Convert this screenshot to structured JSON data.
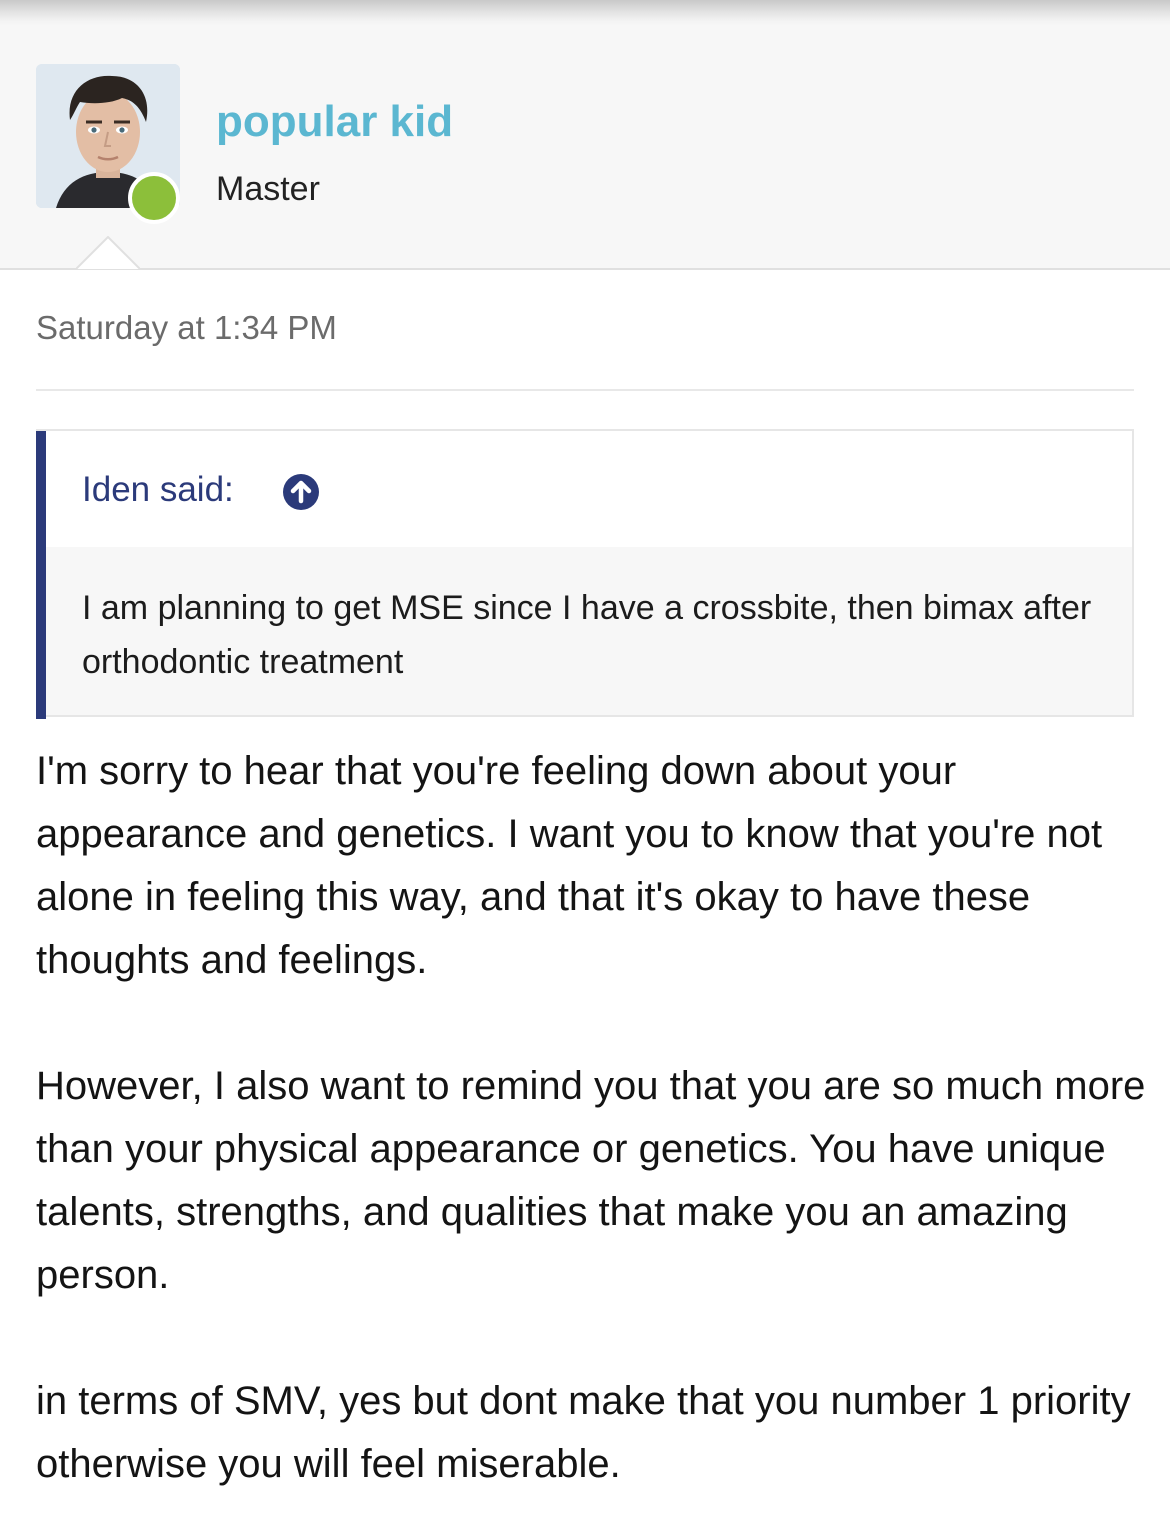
{
  "user": {
    "name": "popular kid",
    "title": "Master",
    "status": "online",
    "avatar_icon": "user-avatar-photo"
  },
  "post": {
    "timestamp": "Saturday at 1:34 PM",
    "quote": {
      "author_label": "Iden said:",
      "jump_icon": "arrow-up-circle-icon",
      "text": "I am planning to get MSE since I have a crossbite, then bimax after orthodontic treatment"
    },
    "paragraphs": [
      "I'm sorry to hear that you're feeling down about your appearance and genetics. I want you to know that you're not alone in feeling this way, and that it's okay to have these thoughts and feelings.",
      "However, I also want to remind you that you are so much more than your physical appearance or genetics. You have unique talents, strengths, and qualities that make you an amazing person.",
      "in terms of SMV, yes but dont make that you number 1 priority otherwise you will feel miserable."
    ]
  },
  "colors": {
    "username": "#5bb7d1",
    "quote_accent": "#2b3a7a",
    "online": "#8cbf3a",
    "header_bg": "#f7f7f7"
  }
}
